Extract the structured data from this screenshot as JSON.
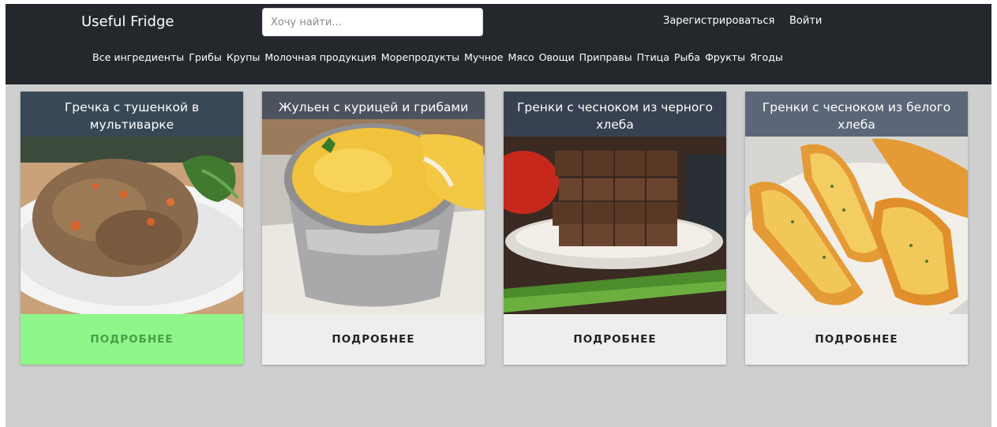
{
  "header": {
    "brand": "Useful Fridge",
    "search_placeholder": "Хочу найти...",
    "register_label": "Зарегистрироваться",
    "login_label": "Войти",
    "categories": [
      "Все ингредиенты",
      "Грибы",
      "Крупы",
      "Молочная продукция",
      "Морепродукты",
      "Мучное",
      "Мясо",
      "Овощи",
      "Приправы",
      "Птица",
      "Рыба",
      "Фрукты",
      "Ягоды"
    ]
  },
  "recipes": [
    {
      "title": "Гречка с тушенкой в мультиварке",
      "more_label": "ПОДРОБНЕЕ",
      "image": "buckwheat-with-stew-photo",
      "highlighted": true
    },
    {
      "title": "Жульен с курицей и грибами",
      "more_label": "ПОДРОБНЕЕ",
      "image": "julienne-photo",
      "highlighted": false
    },
    {
      "title": "Гренки с чесноком из черного хлеба",
      "more_label": "ПОДРОБНЕЕ",
      "image": "black-bread-croutons-photo",
      "highlighted": false
    },
    {
      "title": "Гренки с чесноком из белого хлеба",
      "more_label": "ПОДРОБНЕЕ",
      "image": "white-bread-croutons-photo",
      "highlighted": false
    }
  ],
  "colors": {
    "header_bg": "#24272b",
    "page_bg": "#cfcfcf",
    "card_button_bg": "#eeeeee",
    "card_button_active_bg": "#8ff68a",
    "card_button_active_text": "#48a049",
    "title_band": "#37485f"
  }
}
